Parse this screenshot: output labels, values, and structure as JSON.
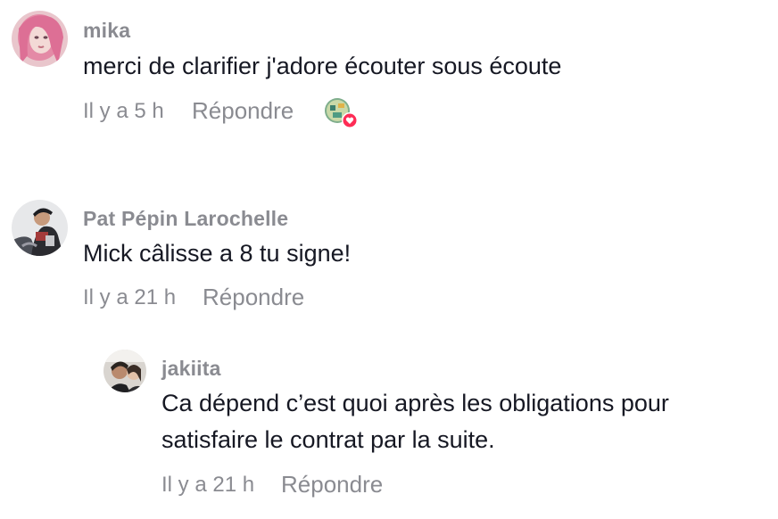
{
  "comments": [
    {
      "username": "mika",
      "text": "merci de clarifier j'adore écouter sous écoute",
      "time": "Il y a 5 h",
      "reply_label": "Répondre"
    },
    {
      "username": "Pat Pépin Larochelle",
      "text": "Mick câlisse a 8 tu signe!",
      "time": "Il y a 21 h",
      "reply_label": "Répondre"
    }
  ],
  "replies": [
    {
      "username": "jakiita",
      "text_lines": [
        "Ca dépend c’est quoi après les obligations pour",
        "satisfaire le contrat par la suite."
      ],
      "time": "Il y a 21 h",
      "reply_label": "Répondre"
    }
  ],
  "icons": {
    "creator_liked": "heart-badge-icon"
  },
  "colors": {
    "text": "#161823",
    "secondary": "#8a8b91",
    "heart": "#fe2c55"
  }
}
